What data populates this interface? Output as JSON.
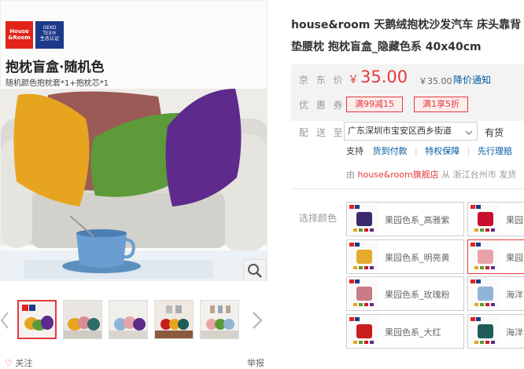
{
  "gallery": {
    "brand_logo_text": "House\n&Room",
    "oeko_logo_text": "OEKO\nTEX®\n生态认证",
    "image_title": "抱枕盲盒·随机色",
    "image_subtitle": "随机颜色抱枕套*1+抱枕芯*1",
    "zoom_icon": "search-icon",
    "thumbnail_count": 5,
    "active_thumbnail": 1
  },
  "footer": {
    "follow_label": "关注",
    "report_label": "举报"
  },
  "product": {
    "title": "house&room 天鹅绒抱枕沙发汽车 床头靠背垫腰枕 抱枕盲盒_隐藏色系 40x40cm",
    "price_label": "京 东 价",
    "price_symbol": "￥",
    "price": "35.00",
    "original_price": "￥35.00",
    "notify_label": "降价通知",
    "promo_label": "优 惠 券",
    "coupons": [
      "满99减15",
      "满1享5折"
    ],
    "accent_color": "#e4393c"
  },
  "shipping": {
    "label": "配 送 至",
    "address": "广东深圳市宝安区西乡街道",
    "stock": "有货",
    "support_label": "支持",
    "services": [
      "货到付款",
      "特权保障",
      "先行理赔"
    ],
    "shop_prefix": "由",
    "shop_name": "house&room旗舰店",
    "shop_suffix": "从 浙江台州市 发货"
  },
  "colors": {
    "label": "选择颜色",
    "options": [
      {
        "name": "果园色系_高雅紫",
        "color": "#3a2a6e"
      },
      {
        "name": "果园",
        "color": "#c8102e"
      },
      {
        "name": "果园色系_明亮黄",
        "color": "#e6a92c"
      },
      {
        "name": "果园",
        "color": "#e9a3a8"
      },
      {
        "name": "果园色系_玫瑰粉",
        "color": "#c97b86"
      },
      {
        "name": "海洋",
        "color": "#8fb4d6"
      },
      {
        "name": "果园色系_大红",
        "color": "#c81e1e"
      },
      {
        "name": "海洋色",
        "color": "#1f5c58"
      }
    ]
  }
}
